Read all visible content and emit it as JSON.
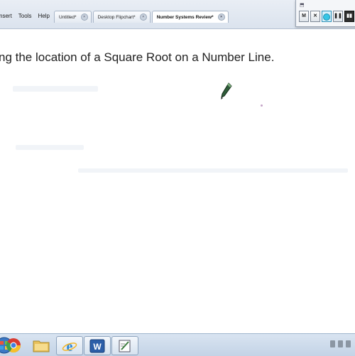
{
  "menu": {
    "items": [
      "nsert",
      "Tools",
      "Help"
    ]
  },
  "tabs": [
    {
      "label": "Untitled*",
      "active": false
    },
    {
      "label": "Desktop Flipchart*",
      "active": false
    },
    {
      "label": "Number Systems Review*",
      "active": true
    }
  ],
  "recorder": {
    "buttons": [
      "M",
      "X",
      "record",
      "pause",
      "stop"
    ]
  },
  "canvas": {
    "title": "ng the location of a Square Root on a Number Line."
  },
  "taskbar": {
    "apps": [
      "start-orb-icon",
      "chrome-icon",
      "folder-icon",
      "internet-explorer-icon",
      "word-icon",
      "flipchart-icon"
    ]
  },
  "colors": {
    "accent": "#36c6e6",
    "title_text": "#222222",
    "annotation_dot": "#c4a3c7"
  }
}
